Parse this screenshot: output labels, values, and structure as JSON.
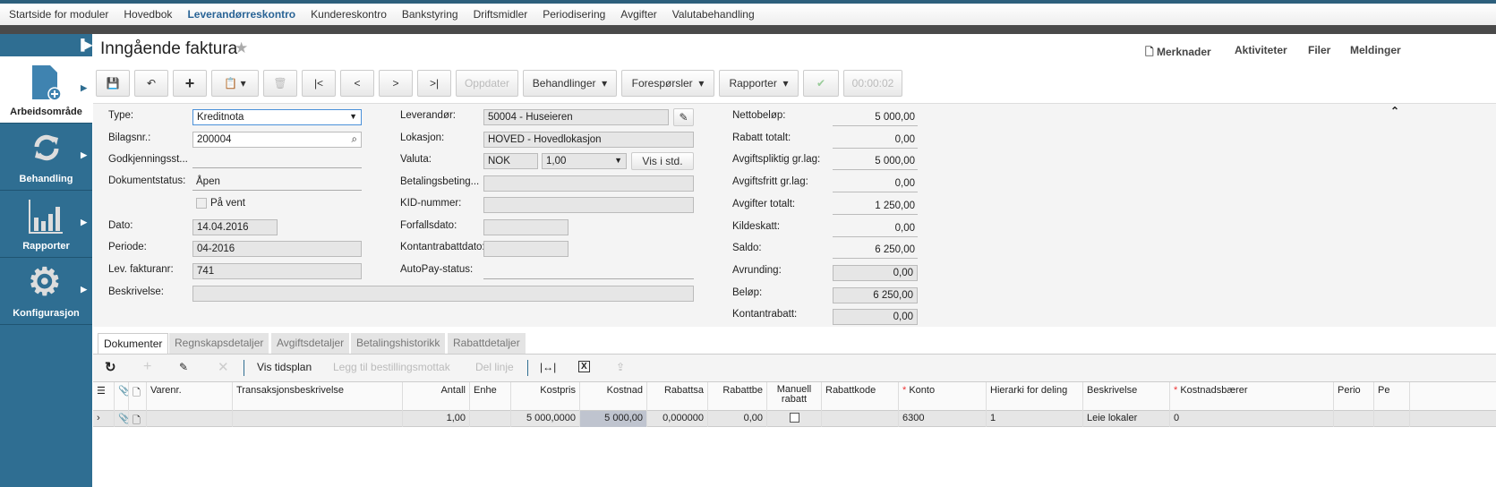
{
  "topnav": [
    "Startside for moduler",
    "Hovedbok",
    "Leverandørreskontro",
    "Kundereskontro",
    "Bankstyring",
    "Driftsmidler",
    "Periodisering",
    "Avgifter",
    "Valutabehandling"
  ],
  "sidebar": {
    "items": [
      {
        "label": "Arbeidsområde"
      },
      {
        "label": "Behandling"
      },
      {
        "label": "Rapporter"
      },
      {
        "label": "Konfigurasjon"
      }
    ]
  },
  "page": {
    "title": "Inngående faktura"
  },
  "toplinks": {
    "notes": "Merknader",
    "activities": "Aktiviteter",
    "files": "Filer",
    "messages": "Meldinger"
  },
  "toolbar": {
    "update": "Oppdater",
    "actions": "Behandlinger",
    "inquiries": "Forespørsler",
    "reports": "Rapporter",
    "timer": "00:00:02"
  },
  "form": {
    "type_label": "Type:",
    "type": "Kreditnota",
    "doc_label": "Bilagsnr.:",
    "doc": "200004",
    "approval_label": "Godkjenningsst...",
    "status_label": "Dokumentstatus:",
    "status": "Åpen",
    "hold_label": "På vent",
    "date_label": "Dato:",
    "date": "14.04.2016",
    "period_label": "Periode:",
    "period": "04-2016",
    "invno_label": "Lev. fakturanr:",
    "invno": "741",
    "desc_label": "Beskrivelse:",
    "vendor_label": "Leverandør:",
    "vendor": "50004 - Huseieren",
    "location_label": "Lokasjon:",
    "location": "HOVED - Hovedlokasjon",
    "currency_label": "Valuta:",
    "currency": "NOK",
    "rate": "1,00",
    "view_base": "Vis i std.",
    "terms_label": "Betalingsbeting...",
    "kid_label": "KID-nummer:",
    "due_label": "Forfallsdato:",
    "cashdisc_label": "Kontantrabattdato:",
    "autopay_label": "AutoPay-status:"
  },
  "totals": [
    {
      "label": "Nettobeløp:",
      "value": "5 000,00"
    },
    {
      "label": "Rabatt totalt:",
      "value": "0,00"
    },
    {
      "label": "Avgiftspliktig gr.lag:",
      "value": "5 000,00"
    },
    {
      "label": "Avgiftsfritt gr.lag:",
      "value": "0,00"
    },
    {
      "label": "Avgifter totalt:",
      "value": "1 250,00"
    },
    {
      "label": "Kildeskatt:",
      "value": "0,00"
    },
    {
      "label": "Saldo:",
      "value": "6 250,00"
    },
    {
      "label": "Avrunding:",
      "value": "0,00"
    },
    {
      "label": "Beløp:",
      "value": "6 250,00"
    },
    {
      "label": "Kontantrabatt:",
      "value": "0,00"
    }
  ],
  "tabs": [
    "Dokumenter",
    "Regnskapsdetaljer",
    "Avgiftsdetaljer",
    "Betalingshistorikk",
    "Rabattdetaljer"
  ],
  "grid_toolbar": {
    "schedule": "Vis tidsplan",
    "add_receipt": "Legg til bestillingsmottak",
    "split": "Del linje"
  },
  "grid": {
    "columns": [
      "Varenr.",
      "Transaksjonsbeskrivelse",
      "Antall",
      "Enhe",
      "Kostpris",
      "Kostnad",
      "Rabattsa",
      "Rabattbe",
      "Manuell rabatt",
      "Rabattkode",
      "Konto",
      "Hierarki for deling",
      "Beskrivelse",
      "Kostnadsbærer",
      "Perio",
      "Pe"
    ],
    "row": [
      "",
      "",
      "1,00",
      "",
      "5 000,0000",
      "5 000,00",
      "0,000000",
      "0,00",
      "",
      "",
      "6300",
      "1",
      "Leie lokaler",
      "0",
      "",
      ""
    ]
  }
}
